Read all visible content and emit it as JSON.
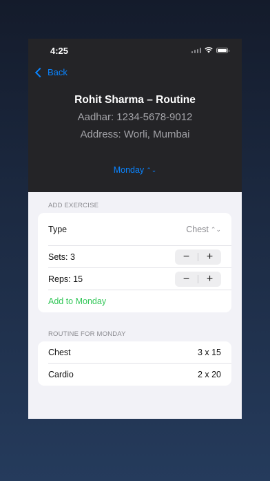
{
  "status": {
    "time": "4:25"
  },
  "nav": {
    "back_label": "Back"
  },
  "header": {
    "title": "Rohit Sharma – Routine",
    "aadhar": "Aadhar: 1234-5678-9012",
    "address": "Address: Worli, Mumbai",
    "day": "Monday",
    "day_picker_icon": "⌃⌄"
  },
  "add_exercise": {
    "section_label": "ADD EXERCISE",
    "type_label": "Type",
    "type_value": "Chest",
    "type_picker_icon": "⌃⌄",
    "sets_label": "Sets: 3",
    "reps_label": "Reps: 15",
    "minus": "−",
    "plus": "+",
    "add_button": "Add to Monday"
  },
  "routine": {
    "section_label": "ROUTINE FOR MONDAY",
    "items": [
      {
        "name": "Chest",
        "value": "3 x 15"
      },
      {
        "name": "Cardio",
        "value": "2 x 20"
      }
    ]
  }
}
